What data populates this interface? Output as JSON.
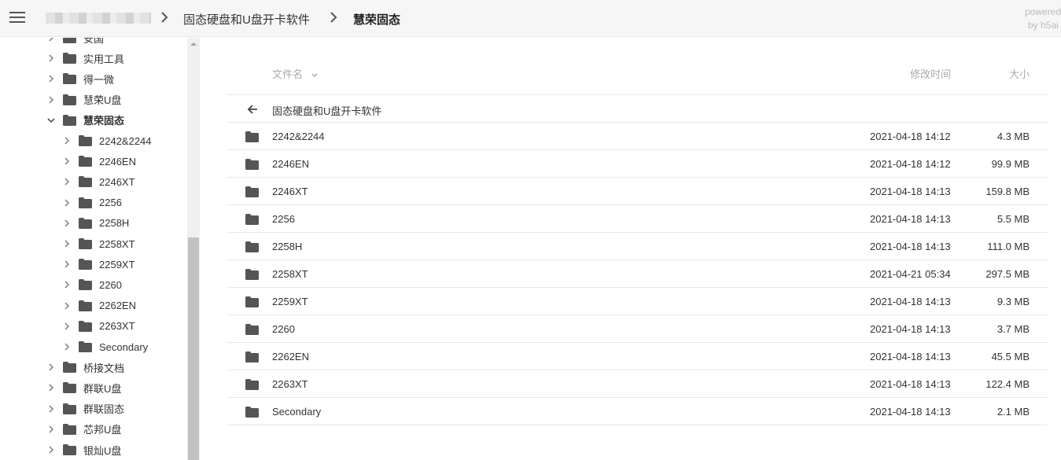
{
  "topbar": {
    "breadcrumbs": [
      {
        "label": "固态硬盘和U盘开卡软件"
      },
      {
        "label": "慧荣固态"
      }
    ],
    "powered": [
      "powered",
      "by h5ai"
    ]
  },
  "sidebar": {
    "items": [
      {
        "label": "安国",
        "level": 1,
        "expanded": false
      },
      {
        "label": "实用工具",
        "level": 1,
        "expanded": false
      },
      {
        "label": "得一微",
        "level": 1,
        "expanded": false
      },
      {
        "label": "慧荣U盘",
        "level": 1,
        "expanded": false
      },
      {
        "label": "慧荣固态",
        "level": 1,
        "expanded": true,
        "active": true
      },
      {
        "label": "2242&2244",
        "level": 2,
        "expanded": false
      },
      {
        "label": "2246EN",
        "level": 2,
        "expanded": false
      },
      {
        "label": "2246XT",
        "level": 2,
        "expanded": false
      },
      {
        "label": "2256",
        "level": 2,
        "expanded": false
      },
      {
        "label": "2258H",
        "level": 2,
        "expanded": false
      },
      {
        "label": "2258XT",
        "level": 2,
        "expanded": false
      },
      {
        "label": "2259XT",
        "level": 2,
        "expanded": false
      },
      {
        "label": "2260",
        "level": 2,
        "expanded": false
      },
      {
        "label": "2262EN",
        "level": 2,
        "expanded": false
      },
      {
        "label": "2263XT",
        "level": 2,
        "expanded": false
      },
      {
        "label": "Secondary",
        "level": 2,
        "expanded": false
      },
      {
        "label": "桥接文档",
        "level": 1,
        "expanded": false
      },
      {
        "label": "群联U盘",
        "level": 1,
        "expanded": false
      },
      {
        "label": "群联固态",
        "level": 1,
        "expanded": false
      },
      {
        "label": "芯邦U盘",
        "level": 1,
        "expanded": false
      },
      {
        "label": "银灿U盘",
        "level": 1,
        "expanded": false
      }
    ]
  },
  "listing": {
    "columns": {
      "name": "文件名",
      "modified": "修改时间",
      "size": "大小"
    },
    "parent": {
      "label": "固态硬盘和U盘开卡软件"
    },
    "rows": [
      {
        "name": "2242&2244",
        "date": "2021-04-18 14:12",
        "size": "4.3 MB"
      },
      {
        "name": "2246EN",
        "date": "2021-04-18 14:12",
        "size": "99.9 MB"
      },
      {
        "name": "2246XT",
        "date": "2021-04-18 14:13",
        "size": "159.8 MB"
      },
      {
        "name": "2256",
        "date": "2021-04-18 14:13",
        "size": "5.5 MB"
      },
      {
        "name": "2258H",
        "date": "2021-04-18 14:13",
        "size": "111.0 MB"
      },
      {
        "name": "2258XT",
        "date": "2021-04-21 05:34",
        "size": "297.5 MB"
      },
      {
        "name": "2259XT",
        "date": "2021-04-18 14:13",
        "size": "9.3 MB"
      },
      {
        "name": "2260",
        "date": "2021-04-18 14:13",
        "size": "3.7 MB"
      },
      {
        "name": "2262EN",
        "date": "2021-04-18 14:13",
        "size": "45.5 MB"
      },
      {
        "name": "2263XT",
        "date": "2021-04-18 14:13",
        "size": "122.4 MB"
      },
      {
        "name": "Secondary",
        "date": "2021-04-18 14:13",
        "size": "2.1 MB"
      }
    ]
  },
  "icons": {
    "menu": "hamburger-menu-icon",
    "chevron": "chevron-right-icon",
    "folder": "folder-icon",
    "back": "arrow-left-icon",
    "sort": "chevron-down-icon"
  },
  "colors": {
    "folder": "#555555",
    "topbar_bg": "#f6f6f6",
    "muted": "#aaaaaa"
  }
}
